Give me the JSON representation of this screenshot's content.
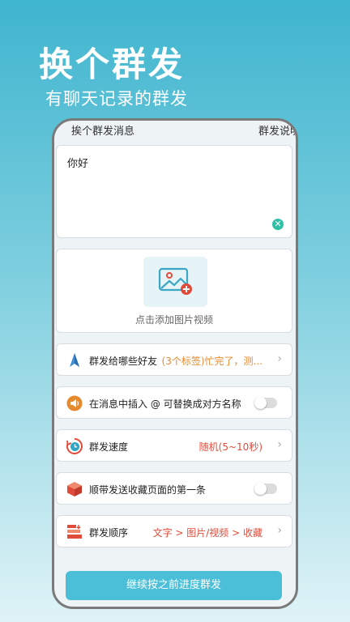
{
  "hero": {
    "title": "换个群发",
    "subtitle": "有聊天记录的群发"
  },
  "screen": {
    "header_title": "挨个群发消息",
    "header_help": "群发说明",
    "message": {
      "text": "你好",
      "clear_icon": "clear-icon"
    },
    "media": {
      "label": "点击添加图片视频",
      "icon": "add-image-icon"
    },
    "settings": [
      {
        "icon": "paper-plane-icon",
        "label": "群发给哪些好友",
        "value": "(3个标签)忙完了，测...",
        "control": "chevron"
      },
      {
        "icon": "speaker-icon",
        "label": "在消息中插入 @ 可替换成对方名称",
        "value": "",
        "control": "toggle"
      },
      {
        "icon": "clock-icon",
        "label": "群发速度",
        "value": "随机(5~10秒)",
        "control": "chevron"
      },
      {
        "icon": "cube-icon",
        "label": "顺带发送收藏页面的第一条",
        "value": "",
        "control": "toggle"
      },
      {
        "icon": "list-order-icon",
        "label": "群发顺序",
        "value": "文字 > 图片/视频 > 收藏",
        "control": "chevron"
      }
    ],
    "bottom_button": "继续按之前进度群发"
  },
  "colors": {
    "accent": "#4cbfd8",
    "value_orange": "#e58a2e",
    "value_red": "#e04b3a",
    "clear_green": "#2fc0a8"
  }
}
